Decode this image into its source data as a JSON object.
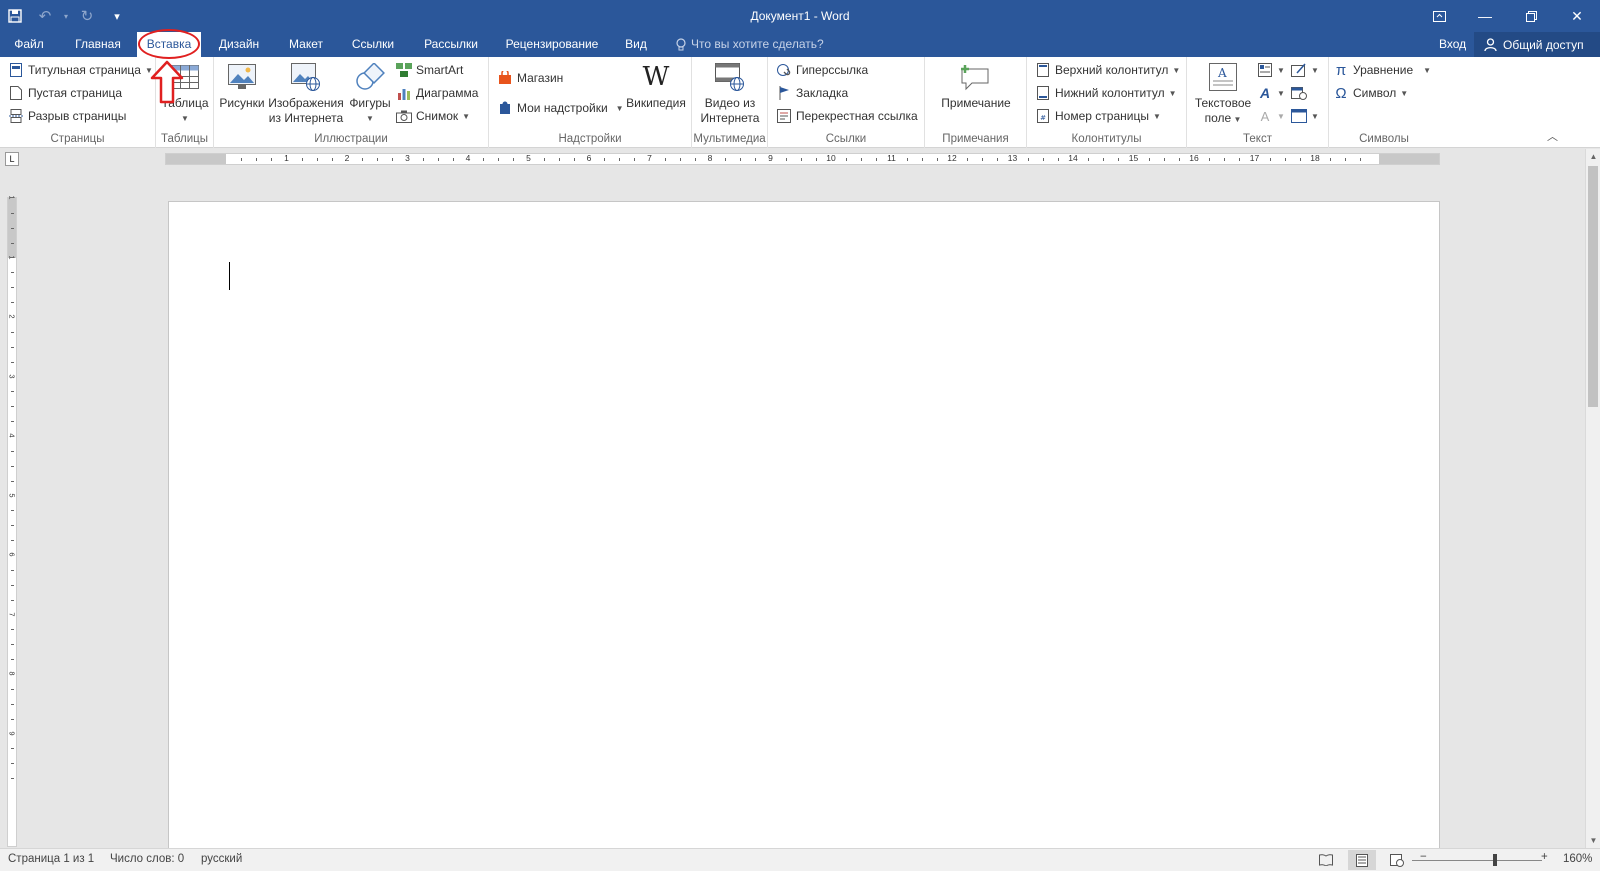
{
  "window": {
    "title": "Документ1 - Word"
  },
  "qat": {
    "save": "save-icon",
    "undo": "undo-icon",
    "redo": "redo-icon",
    "customize": "customize-qat-icon"
  },
  "tabs": [
    {
      "label": "Файл"
    },
    {
      "label": "Главная"
    },
    {
      "label": "Вставка"
    },
    {
      "label": "Дизайн"
    },
    {
      "label": "Макет"
    },
    {
      "label": "Ссылки"
    },
    {
      "label": "Рассылки"
    },
    {
      "label": "Рецензирование"
    },
    {
      "label": "Вид"
    }
  ],
  "tell_me": {
    "placeholder": "Что вы хотите сделать?"
  },
  "account": {
    "signin": "Вход",
    "share": "Общий доступ"
  },
  "ribbon": {
    "pages": {
      "label": "Страницы",
      "cover": "Титульная страница",
      "blank": "Пустая страница",
      "break": "Разрыв страницы"
    },
    "tables": {
      "label": "Таблицы",
      "table": "Таблица"
    },
    "illustrations": {
      "label": "Иллюстрации",
      "pictures": "Рисунки",
      "online_1": "Изображения",
      "online_2": "из Интернета",
      "shapes": "Фигуры",
      "smartart": "SmartArt",
      "chart": "Диаграмма",
      "screenshot": "Снимок"
    },
    "addins": {
      "label": "Надстройки",
      "store": "Магазин",
      "my_addins": "Мои надстройки",
      "wikipedia": "Википедия"
    },
    "media": {
      "label": "Мультимедиа",
      "video_1": "Видео из",
      "video_2": "Интернета"
    },
    "links": {
      "label": "Ссылки",
      "hyperlink": "Гиперссылка",
      "bookmark": "Закладка",
      "crossref": "Перекрестная ссылка"
    },
    "comments": {
      "label": "Примечания",
      "comment": "Примечание"
    },
    "header_footer": {
      "label": "Колонтитулы",
      "header": "Верхний колонтитул",
      "footer": "Нижний колонтитул",
      "page_number": "Номер страницы"
    },
    "text": {
      "label": "Текст",
      "textbox_1": "Текстовое",
      "textbox_2": "поле"
    },
    "symbols": {
      "label": "Символы",
      "equation": "Уравнение",
      "symbol": "Символ"
    }
  },
  "ruler": {
    "h_numbers": [
      "1",
      "2",
      "3",
      "4",
      "5",
      "6",
      "7",
      "8",
      "9",
      "10",
      "11",
      "12",
      "13",
      "14",
      "15",
      "16",
      "17",
      "18"
    ],
    "v_numbers": [
      "1",
      "1",
      "2",
      "3",
      "4",
      "5",
      "6",
      "7",
      "8",
      "9"
    ]
  },
  "status": {
    "page": "Страница 1 из 1",
    "words": "Число слов: 0",
    "language": "русский",
    "zoom": "160%"
  },
  "colors": {
    "accent": "#2b579a",
    "highlight": "#e02020"
  }
}
